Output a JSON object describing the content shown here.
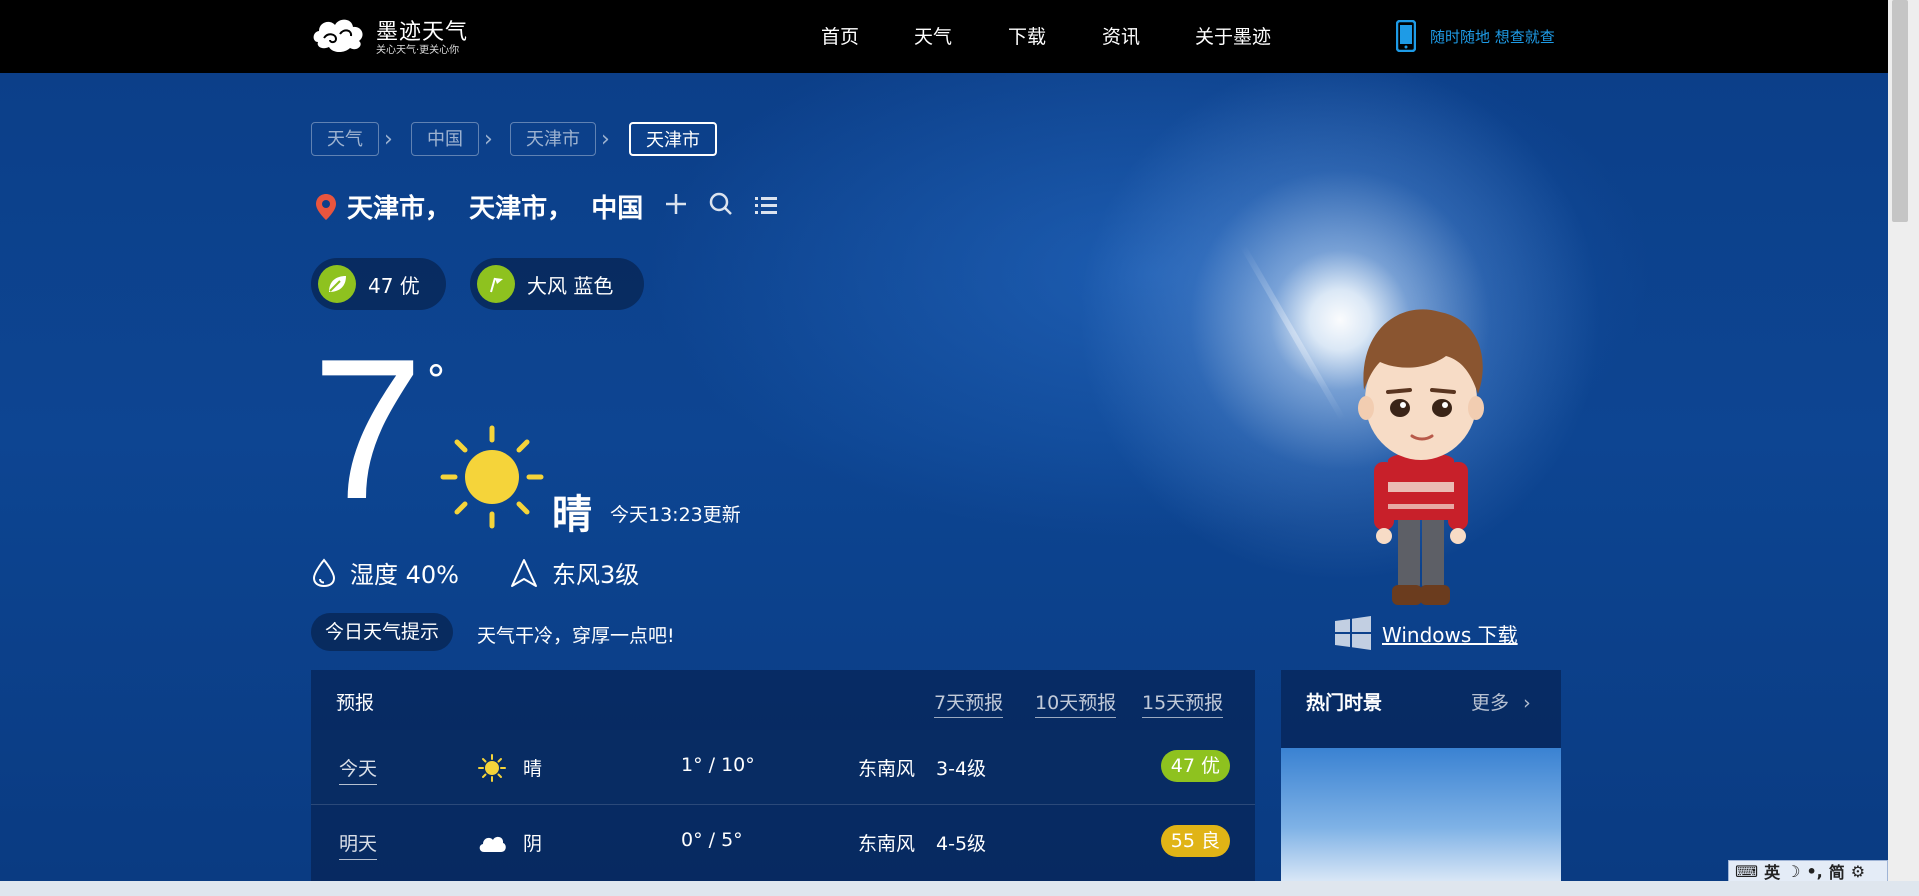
{
  "brand": {
    "name": "墨迹天气",
    "tagline": "关心天气·更关心你"
  },
  "nav": {
    "items": [
      "首页",
      "天气",
      "下载",
      "资讯",
      "关于墨迹"
    ],
    "slogan": "随时随地 想查就查"
  },
  "breadcrumb": [
    "天气",
    "中国",
    "天津市",
    "天津市"
  ],
  "location": {
    "name": "天津市，  天津市，  中国"
  },
  "badges": {
    "aqi": "47 优",
    "alert": "大风 蓝色"
  },
  "current": {
    "temp": "7",
    "degree": "°",
    "condition": "晴",
    "update": "今天13:23更新",
    "humidity": "湿度 40%",
    "wind": "东风3级"
  },
  "tip": {
    "label": "今日天气提示",
    "text": "天气干冷，穿厚一点吧!"
  },
  "windows_download": "Windows 下载",
  "forecast": {
    "title": "预报",
    "tabs": [
      "7天预报",
      "10天预报",
      "15天预报"
    ],
    "rows": [
      {
        "day": "今天",
        "icon": "sun-icon",
        "condition": "晴",
        "temp": "1° / 10°",
        "wind_dir": "东南风",
        "wind_level": "3-4级",
        "aqi": "47 优",
        "aqi_color": "#8ec21f"
      },
      {
        "day": "明天",
        "icon": "cloud-icon",
        "condition": "阴",
        "temp": "0° / 5°",
        "wind_dir": "东南风",
        "wind_level": "4-5级",
        "aqi": "55 良",
        "aqi_color": "#e0b416"
      }
    ]
  },
  "hot": {
    "title": "热门时景",
    "more": "更多"
  },
  "ime": {
    "lang": "英",
    "mode": "简"
  },
  "colors": {
    "accent": "#1e9be6",
    "aqi_good": "#8ec21f",
    "aqi_moderate": "#e0b416",
    "pin": "#e8553e"
  }
}
